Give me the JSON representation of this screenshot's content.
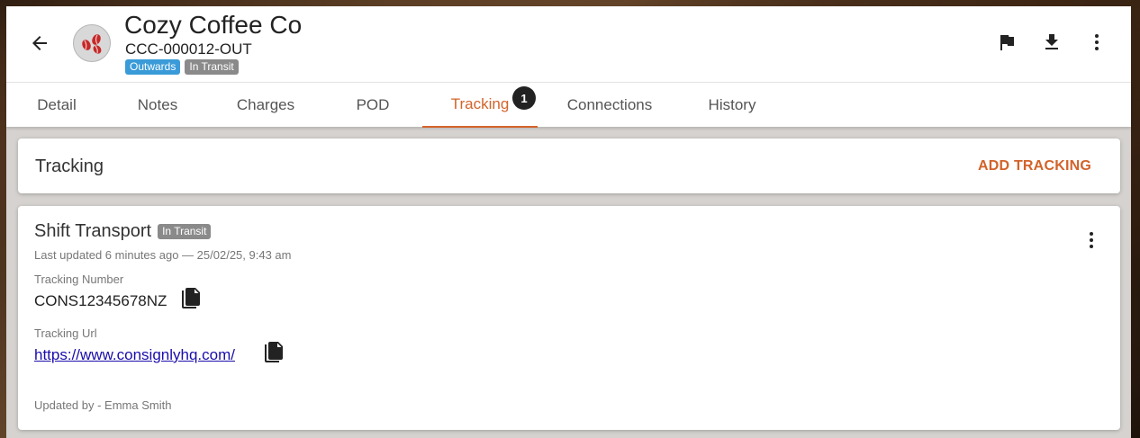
{
  "header": {
    "company": "Cozy Coffee Co",
    "reference": "CCC-000012-OUT",
    "badges": [
      {
        "label": "Outwards",
        "color": "#3a9bd8"
      },
      {
        "label": "In Transit",
        "color": "#8a8a8a"
      }
    ],
    "icons": {
      "back": "arrow-left-icon",
      "avatar": "coffee-beans-icon",
      "flag": "flag-icon",
      "download": "download-icon",
      "more": "more-vertical-icon"
    }
  },
  "tabs": [
    {
      "label": "Detail"
    },
    {
      "label": "Notes"
    },
    {
      "label": "Charges"
    },
    {
      "label": "POD"
    },
    {
      "label": "Tracking",
      "active": true,
      "count": "1"
    },
    {
      "label": "Connections"
    },
    {
      "label": "History"
    }
  ],
  "tracking_section": {
    "title": "Tracking",
    "add_label": "ADD TRACKING"
  },
  "tracking_entry": {
    "carrier": "Shift Transport",
    "status": "In Transit",
    "last_updated": "Last updated 6 minutes ago — 25/02/25, 9:43 am",
    "number_label": "Tracking Number",
    "number_value": "CONS12345678NZ",
    "url_label": "Tracking Url",
    "url_value": "https://www.consignlyhq.com/",
    "updated_by": "Updated by - Emma Smith"
  },
  "colors": {
    "accent": "#d2632a",
    "badge_blue": "#3a9bd8",
    "badge_grey": "#8a8a8a",
    "link": "#1a0dab"
  }
}
